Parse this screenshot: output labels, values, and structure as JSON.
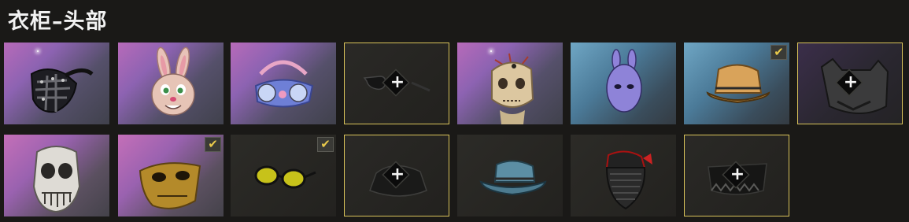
{
  "header": {
    "title": "衣柜–头部"
  },
  "row1": [
    {
      "name": "spiked-mask-icon",
      "checked": false,
      "equipped": false
    },
    {
      "name": "bunny-mask-icon",
      "checked": false,
      "equipped": false
    },
    {
      "name": "bunny-respirator-icon",
      "checked": false,
      "equipped": false
    },
    {
      "name": "sunglasses-slot-empty",
      "checked": false,
      "equipped": true
    },
    {
      "name": "scarecrow-mask-icon",
      "checked": false,
      "equipped": false
    },
    {
      "name": "purple-rabbit-mask-icon",
      "checked": false,
      "equipped": false
    },
    {
      "name": "orange-bucket-hat-icon",
      "checked": true,
      "equipped": false
    },
    {
      "name": "wolf-mask-icon",
      "checked": false,
      "equipped": true
    }
  ],
  "row2": [
    {
      "name": "skull-mask-icon",
      "checked": false,
      "equipped": false
    },
    {
      "name": "gold-half-mask-icon",
      "checked": true,
      "equipped": false
    },
    {
      "name": "yellow-sunglasses-icon",
      "checked": true,
      "equipped": false
    },
    {
      "name": "hat-slot-empty",
      "checked": false,
      "equipped": true
    },
    {
      "name": "teal-bucket-hat-icon",
      "checked": false,
      "equipped": false
    },
    {
      "name": "face-mask-icon",
      "checked": false,
      "equipped": false
    },
    {
      "name": "face-cover-slot-empty",
      "checked": false,
      "equipped": true
    }
  ],
  "icons": {
    "check": "✔",
    "plus": "+"
  },
  "colors": {
    "gold_border": "#d9c35a",
    "check": "#e8c94b"
  }
}
